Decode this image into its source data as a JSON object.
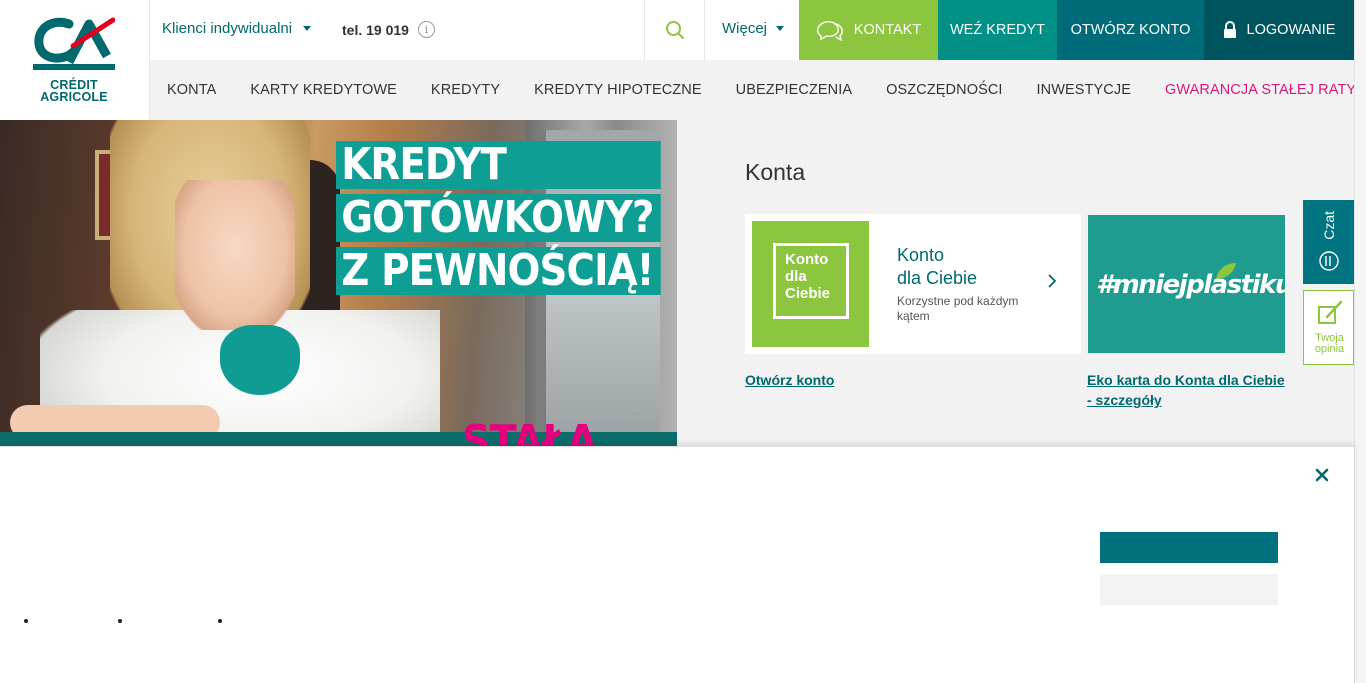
{
  "brand": {
    "name_line1": "CRÉDIT",
    "name_line2": "AGRICOLE",
    "colors": {
      "primary": "#00696e",
      "green": "#8cc63f",
      "pink": "#d4197e",
      "accent_red": "#e2001a"
    }
  },
  "topbar": {
    "segment": "Klienci indywidualni",
    "phone": "tel. 19 019",
    "info_icon": "i",
    "more": "Więcej",
    "buttons": {
      "kontakt": "KONTAKT",
      "wez_kredyt": "WEŹ KREDYT",
      "otworz_konto": "OTWÓRZ KONTO",
      "logowanie": "LOGOWANIE"
    }
  },
  "nav": {
    "items": [
      {
        "label": "KONTA"
      },
      {
        "label": "KARTY KREDYTOWE"
      },
      {
        "label": "KREDYTY"
      },
      {
        "label": "KREDYTY HIPOTECZNE"
      },
      {
        "label": "UBEZPIECZENIA"
      },
      {
        "label": "OSZCZĘDNOŚCI"
      },
      {
        "label": "INWESTYCJE"
      },
      {
        "label": "GWARANCJA STAŁEJ RATY"
      }
    ]
  },
  "hero": {
    "line1": "KREDYT",
    "line2": "GOTÓWKOWY?",
    "line3": "Z PEWNOŚCIĄ!",
    "line4": "STAŁA"
  },
  "konta": {
    "title": "Konta",
    "card": {
      "logo_line1": "Konto",
      "logo_line2": "dla",
      "logo_line3": "Ciebie",
      "title_line1": "Konto",
      "title_line2": "dla Ciebie",
      "desc": "Korzystne pod każdym kątem"
    },
    "promo": {
      "text": "#mniejplastiku"
    },
    "links": {
      "open": "Otwórz konto",
      "eko": "Eko karta do Konta dla Ciebie - szczegóły"
    }
  },
  "side": {
    "chat": "Czat",
    "opinion_line1": "Twoja",
    "opinion_line2": "opinia"
  },
  "cookie": {
    "close_icon": "close-icon"
  }
}
